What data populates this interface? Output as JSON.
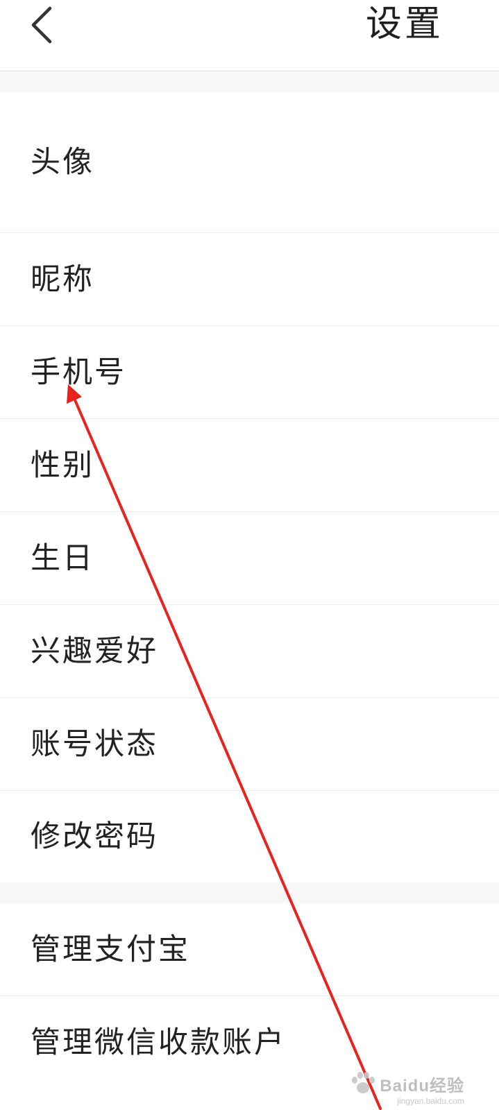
{
  "header": {
    "back_icon": "chevron-left-icon",
    "title": "设置"
  },
  "settings_items": [
    {
      "key": "avatar",
      "label": "头像"
    },
    {
      "key": "nickname",
      "label": "昵称"
    },
    {
      "key": "phone",
      "label": "手机号"
    },
    {
      "key": "gender",
      "label": "性别"
    },
    {
      "key": "birthday",
      "label": "生日"
    },
    {
      "key": "hobbies",
      "label": "兴趣爱好"
    },
    {
      "key": "account_status",
      "label": "账号状态"
    },
    {
      "key": "change_password",
      "label": "修改密码"
    }
  ],
  "payment_items": [
    {
      "key": "alipay",
      "label": "管理支付宝"
    },
    {
      "key": "wechat",
      "label": "管理微信收款账户"
    }
  ],
  "annotation": {
    "type": "arrow",
    "color": "#e8231e",
    "points_to": "手机号"
  },
  "watermark": {
    "logo_text": "Baidu经验",
    "url_text": "jingyan.baidu.com"
  }
}
